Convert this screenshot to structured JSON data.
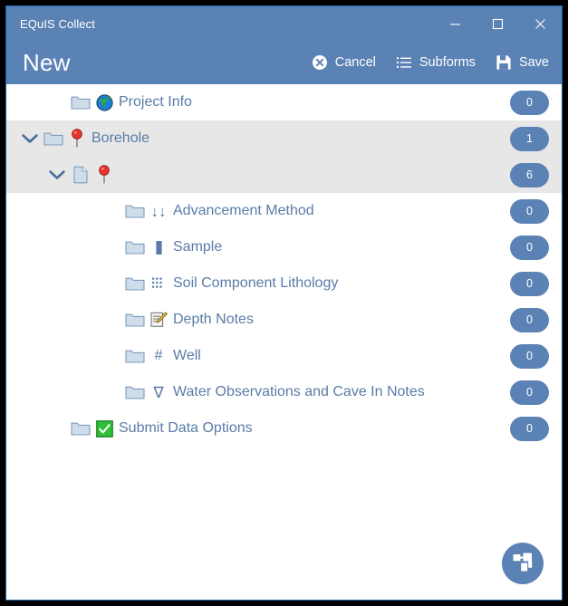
{
  "window": {
    "app_title": "EQuIS Collect",
    "controls": [
      {
        "name": "minimize-button",
        "glyph": "minimize-icon"
      },
      {
        "name": "maximize-button",
        "glyph": "maximize-icon"
      },
      {
        "name": "close-button",
        "glyph": "close-icon"
      }
    ]
  },
  "command_bar": {
    "heading": "New",
    "actions": [
      {
        "label": "Cancel",
        "icon": "cancel-circle-icon"
      },
      {
        "label": "Subforms",
        "icon": "list-icon"
      },
      {
        "label": "Save",
        "icon": "floppy-disk-icon"
      }
    ]
  },
  "tree": {
    "rows": [
      {
        "label": "Project Info",
        "count": "0",
        "depth": 1,
        "expandable": false,
        "expanded": false,
        "shaded": false,
        "folder_icon": "folder-icon",
        "type_icon": "globe-icon"
      },
      {
        "label": "Borehole",
        "count": "1",
        "depth": 0,
        "expandable": true,
        "expanded": true,
        "shaded": true,
        "folder_icon": "folder-icon",
        "type_icon": "map-pin-icon"
      },
      {
        "label": "",
        "count": "6",
        "depth": 1,
        "expandable": true,
        "expanded": true,
        "shaded": true,
        "folder_icon": "document-icon",
        "type_icon": "map-pin-icon"
      },
      {
        "label": "Advancement Method",
        "count": "0",
        "depth": 3,
        "expandable": false,
        "expanded": false,
        "shaded": false,
        "folder_icon": "folder-icon",
        "type_icon": "double-down-arrow-icon"
      },
      {
        "label": "Sample",
        "count": "0",
        "depth": 3,
        "expandable": false,
        "expanded": false,
        "shaded": false,
        "folder_icon": "folder-icon",
        "type_icon": "filled-rect-icon"
      },
      {
        "label": "Soil Component Lithology",
        "count": "0",
        "depth": 3,
        "expandable": false,
        "expanded": false,
        "shaded": false,
        "folder_icon": "folder-icon",
        "type_icon": "grid-dots-icon"
      },
      {
        "label": "Depth Notes",
        "count": "0",
        "depth": 3,
        "expandable": false,
        "expanded": false,
        "shaded": false,
        "folder_icon": "folder-icon",
        "type_icon": "note-pencil-icon"
      },
      {
        "label": "Well",
        "count": "0",
        "depth": 3,
        "expandable": false,
        "expanded": false,
        "shaded": false,
        "folder_icon": "folder-icon",
        "type_icon": "hash-icon"
      },
      {
        "label": "Water Observations and Cave In Notes",
        "count": "0",
        "depth": 3,
        "expandable": false,
        "expanded": false,
        "shaded": false,
        "folder_icon": "folder-icon",
        "type_icon": "nabla-triangle-icon"
      },
      {
        "label": "Submit Data Options",
        "count": "0",
        "depth": 1,
        "expandable": false,
        "expanded": false,
        "shaded": false,
        "folder_icon": "folder-icon",
        "type_icon": "green-check-icon"
      }
    ]
  },
  "fab": {
    "icon": "hierarchy-icon"
  },
  "colors": {
    "header_blue": "#5b82b4",
    "window_border": "#1763a8",
    "row_alt": "#e7e7e7",
    "label_blue": "#5a7ca8",
    "badge_blue": "#5b82b4",
    "check_green": "#2cc036",
    "pin_red": "#e8322a"
  }
}
